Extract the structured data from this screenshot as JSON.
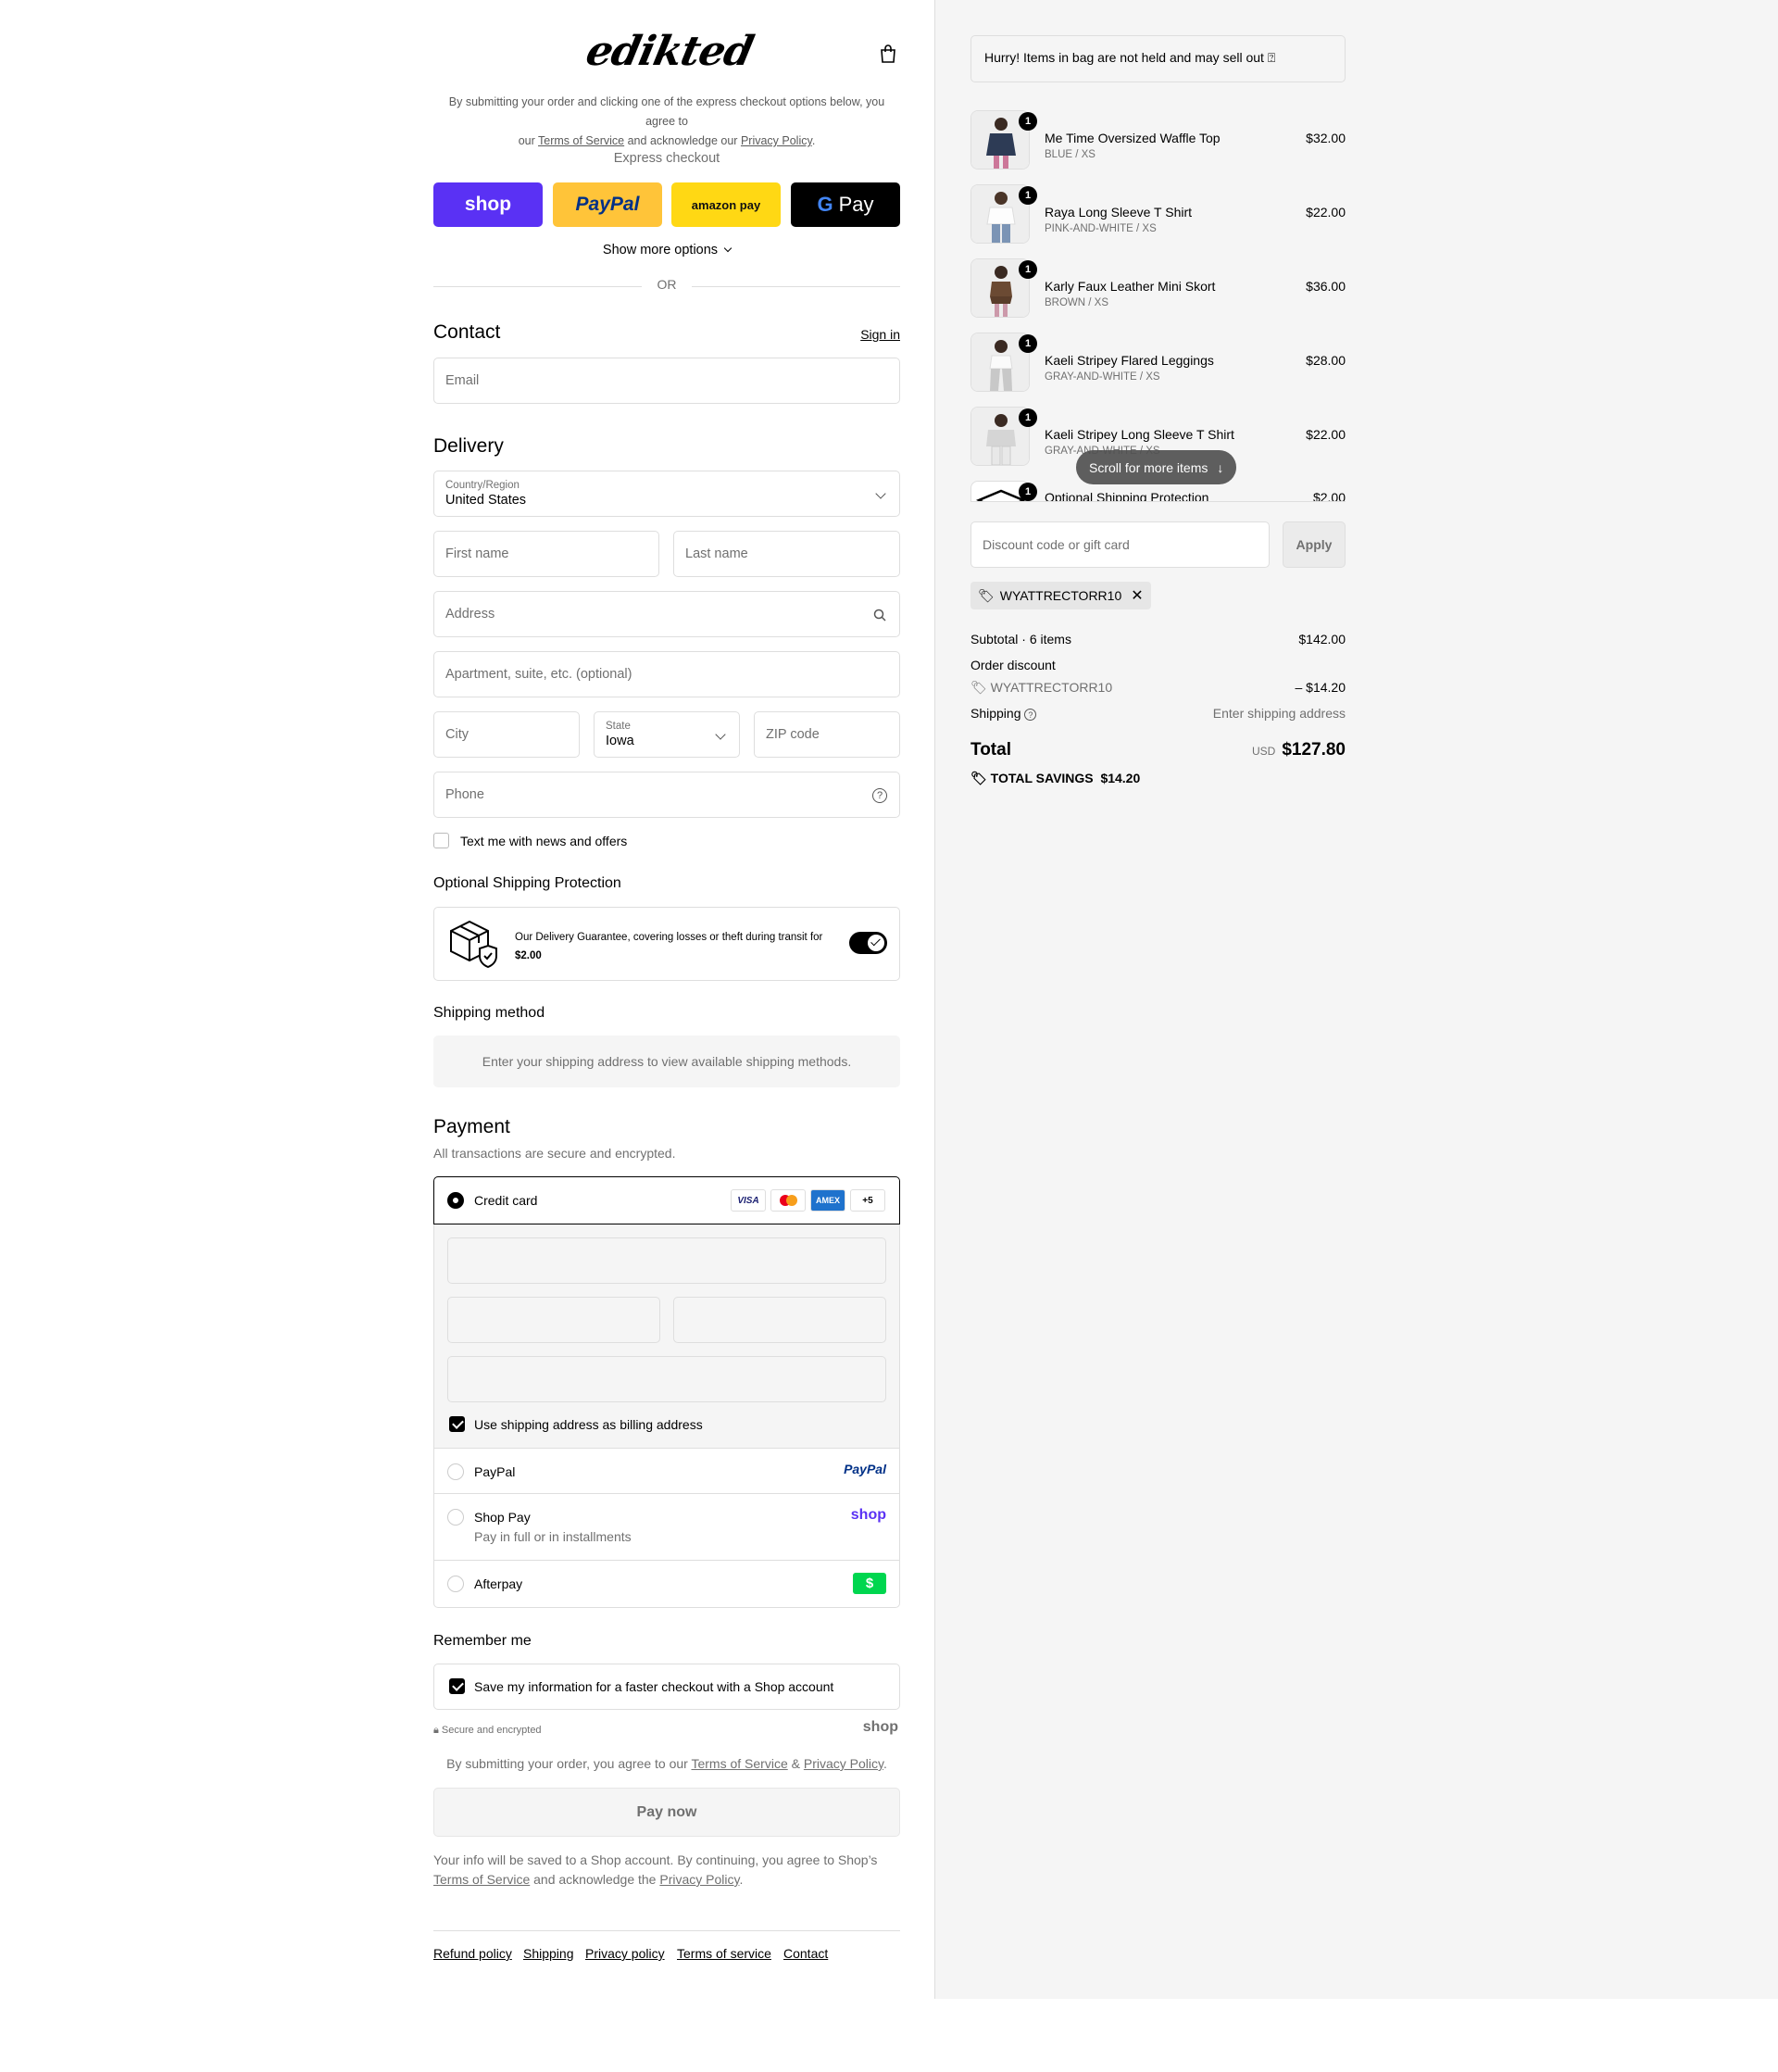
{
  "header": {
    "logo": "edikted",
    "terms_line1": "By submitting your order and clicking one of the express checkout options below, you agree to",
    "terms_our": "our",
    "terms_tos": "Terms of Service",
    "terms_mid": "and acknowledge our",
    "terms_pp": "Privacy Policy",
    "terms_end": "."
  },
  "express": {
    "label": "Express checkout",
    "shop": "shop",
    "paypal": "PayPal",
    "amazon": "amazon pay",
    "gpay": "Pay",
    "more": "Show more options",
    "or": "OR"
  },
  "contact": {
    "title": "Contact",
    "signin": "Sign in",
    "email_placeholder": "Email"
  },
  "delivery": {
    "title": "Delivery",
    "country_label": "Country/Region",
    "country_value": "United States",
    "first_name": "First name",
    "last_name": "Last name",
    "address": "Address",
    "apartment": "Apartment, suite, etc. (optional)",
    "city": "City",
    "state_label": "State",
    "state_value": "Iowa",
    "zip": "ZIP code",
    "phone": "Phone",
    "text_me": "Text me with news and offers"
  },
  "protection": {
    "title": "Optional Shipping Protection",
    "text": "Our Delivery Guarantee, covering losses or theft during transit for",
    "price": "$2.00"
  },
  "shipping_method": {
    "title": "Shipping method",
    "note": "Enter your shipping address to view available shipping methods."
  },
  "payment": {
    "title": "Payment",
    "subtitle": "All transactions are secure and encrypted.",
    "credit_card": "Credit card",
    "cards": [
      "VISA",
      "MC",
      "AMEX",
      "+5"
    ],
    "billing": "Use shipping address as billing address",
    "paypal": "PayPal",
    "paypal_logo": "PayPal",
    "shoppay": "Shop Pay",
    "shoppay_sub": "Pay in full or in installments",
    "shoppay_logo": "shop",
    "afterpay": "Afterpay",
    "afterpay_logo": "$"
  },
  "remember": {
    "title": "Remember me",
    "save": "Save my information for a faster checkout with a Shop account",
    "secure": "Secure and encrypted",
    "shop_logo": "shop"
  },
  "submit": {
    "agree_pre": "By submitting your order, you agree to our",
    "agree_tos": "Terms of Service",
    "agree_amp": "&",
    "agree_pp": "Privacy Policy",
    "agree_end": ".",
    "button": "Pay now",
    "info_line1": "Your info will be saved to a Shop account. By continuing, you agree to Shop’s",
    "info_tos": "Terms of Service",
    "info_mid": "and acknowledge the",
    "info_pp": "Privacy Policy",
    "info_end": "."
  },
  "footer": [
    "Refund policy",
    "Shipping",
    "Privacy policy",
    "Terms of service",
    "Contact"
  ],
  "summary": {
    "banner": "Hurry! Items in bag are not held and may sell out ⍰",
    "items": [
      {
        "name": "Me Time Oversized Waffle Top",
        "variant": "BLUE / XS",
        "price": "$32.00",
        "qty": "1"
      },
      {
        "name": "Raya Long Sleeve T Shirt",
        "variant": "PINK-AND-WHITE / XS",
        "price": "$22.00",
        "qty": "1"
      },
      {
        "name": "Karly Faux Leather Mini Skort",
        "variant": "BROWN / XS",
        "price": "$36.00",
        "qty": "1"
      },
      {
        "name": "Kaeli Stripey Flared Leggings",
        "variant": "GRAY-AND-WHITE / XS",
        "price": "$28.00",
        "qty": "1"
      },
      {
        "name": "Kaeli Stripey Long Sleeve T Shirt",
        "variant": "GRAY-AND-WHITE / XS",
        "price": "$22.00",
        "qty": "1"
      },
      {
        "name": "Optional Shipping Protection",
        "variant": "",
        "price": "$2.00",
        "qty": "1"
      }
    ],
    "scroll_more": "Scroll for more items",
    "discount_placeholder": "Discount code or gift card",
    "apply": "Apply",
    "code_tag": "WYATTRECTORR10",
    "subtotal_label": "Subtotal · 6 items",
    "subtotal": "$142.00",
    "order_discount": "Order discount",
    "discount_code": "WYATTRECTORR10",
    "discount_amount": "– $14.20",
    "shipping_label": "Shipping",
    "shipping_value": "Enter shipping address",
    "total_label": "Total",
    "currency": "USD",
    "total": "$127.80",
    "savings_label": "TOTAL SAVINGS",
    "savings": "$14.20"
  }
}
